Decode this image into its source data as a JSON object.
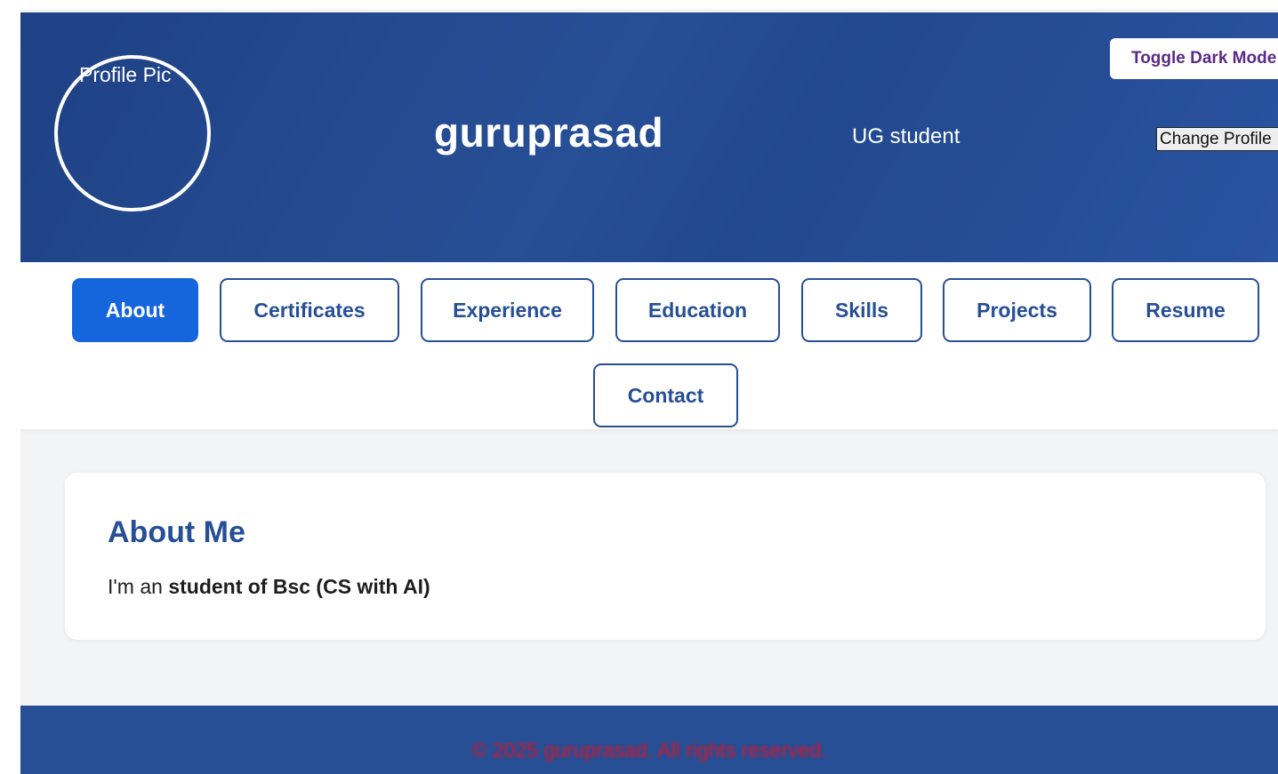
{
  "header": {
    "avatar_alt": "Profile Pic",
    "name": "guruprasad",
    "role": "UG student",
    "toggle_label": "Toggle Dark Mode",
    "change_profile_label": "Change Profile"
  },
  "nav": {
    "tabs": [
      {
        "label": "About",
        "active": true
      },
      {
        "label": "Certificates"
      },
      {
        "label": "Experience"
      },
      {
        "label": "Education"
      },
      {
        "label": "Skills"
      },
      {
        "label": "Projects"
      },
      {
        "label": "Resume"
      },
      {
        "label": "Contact"
      }
    ]
  },
  "about": {
    "title": "About Me",
    "text_prefix": "I'm an ",
    "text_bold": "student of Bsc (CS with AI)"
  },
  "footer": {
    "text": "© 2025 guruprasad. All rights reserved."
  },
  "colors": {
    "primary": "#274f95",
    "active_tab": "#1565dc",
    "footer_text": "#d2152a"
  }
}
